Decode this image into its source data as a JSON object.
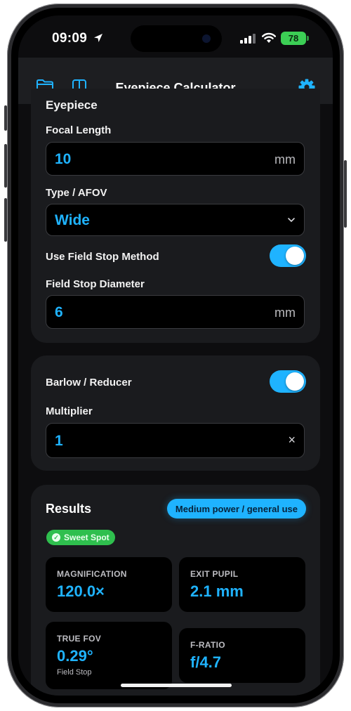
{
  "status_bar": {
    "time": "09:09",
    "battery": "78"
  },
  "nav": {
    "title": "Eyepiece Calculator"
  },
  "eyepiece": {
    "section_title": "Eyepiece",
    "focal_length_label": "Focal Length",
    "focal_length_value": "10",
    "focal_length_unit": "mm",
    "type_label": "Type / AFOV",
    "type_value": "Wide",
    "field_stop_method_label": "Use Field Stop Method",
    "field_stop_method_on": true,
    "field_stop_diameter_label": "Field Stop Diameter",
    "field_stop_diameter_value": "6",
    "field_stop_diameter_unit": "mm"
  },
  "barlow": {
    "label": "Barlow / Reducer",
    "enabled": true,
    "multiplier_label": "Multiplier",
    "multiplier_value": "1",
    "clear_symbol": "×"
  },
  "results": {
    "title": "Results",
    "usage_pill": "Medium power / general use",
    "sweet_spot_badge": "Sweet Spot",
    "stats": [
      {
        "label": "MAGNIFICATION",
        "value": "120.0×",
        "sub": ""
      },
      {
        "label": "EXIT PUPIL",
        "value": "2.1 mm",
        "sub": ""
      },
      {
        "label": "TRUE FOV",
        "value": "0.29°",
        "sub": "Field Stop"
      },
      {
        "label": "F-RATIO",
        "value": "f/4.7",
        "sub": ""
      }
    ]
  },
  "colors": {
    "accent": "#1fb3ff",
    "success": "#2fbf4e",
    "card": "#1a1b1e"
  },
  "icons": [
    "location-arrow-icon",
    "cellular-signal-icon",
    "wifi-icon",
    "battery-icon",
    "folder-icon",
    "sidebar-icon",
    "gear-icon",
    "chevron-down-icon",
    "checkmark-icon"
  ]
}
